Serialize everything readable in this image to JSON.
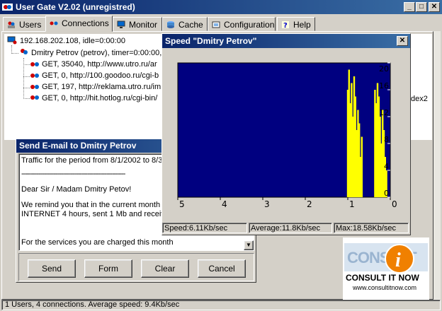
{
  "app": {
    "title": "User Gate V2.02 (unregistred)",
    "controls": {
      "minimize": "_",
      "maximize": "□",
      "close": "✕"
    }
  },
  "tabs": [
    {
      "label": "Users",
      "icon": "users-icon",
      "active": false
    },
    {
      "label": "Connections",
      "icon": "connections-icon",
      "active": true
    },
    {
      "label": "Monitor",
      "icon": "monitor-icon",
      "active": false
    },
    {
      "label": "Cache",
      "icon": "cache-icon",
      "active": false
    },
    {
      "label": "Configuration",
      "icon": "configuration-icon",
      "active": false
    },
    {
      "label": "Help",
      "icon": "help-icon",
      "active": false
    }
  ],
  "tree": {
    "root": "192.168.202.108, idle=0:00:00",
    "user": "Dmitry Petrov (petrov), timer=0:00:00, id",
    "requests": [
      "GET, 35040, http://www.utro.ru/ar",
      "GET, 0, http://100.goodoo.ru/cgi-b",
      "GET, 197, http://reklama.utro.ru/im",
      "GET, 0, http://hit.hotlog.ru/cgi-bin/"
    ],
    "right_fragment": "dex2"
  },
  "email_dialog": {
    "title": "Send E-mail to Dmitry Petrov",
    "period_line": "Traffic for the period from  8/1/2002 to 8/3",
    "separator": "-------------------------------------------------------",
    "greeting": "Dear Sir / Madam Dmitry Petov!",
    "body_line1": "We remind you that in the current month yo",
    "body_line2": "INTERNET 4 hours, sent 1 Mb and receiv",
    "body_line3": "For the services you are charged this month",
    "buttons": {
      "send": "Send",
      "form": "Form",
      "clear": "Clear",
      "cancel": "Cancel"
    }
  },
  "speed_window": {
    "title": "Speed \"Dmitry Petrov\"",
    "close": "✕",
    "status": {
      "speed": "Speed:6.11Kb/sec",
      "average": "Average:11.8Kb/sec",
      "max": "Max:18.58Kb/sec"
    },
    "colors": {
      "plot_bg": "#000080",
      "bar": "#ffff00"
    }
  },
  "chart_data": {
    "type": "bar",
    "title": "",
    "xlabel": "",
    "ylabel": "",
    "x_ticks": [
      "5",
      "4",
      "3",
      "2",
      "1",
      "0"
    ],
    "y_ticks": [
      "20",
      "16",
      "12",
      "8",
      "4",
      "0"
    ],
    "xlim": [
      5,
      0
    ],
    "ylim": [
      0,
      20
    ],
    "grid": false,
    "x": [
      1.0,
      0.97,
      0.94,
      0.91,
      0.88,
      0.85,
      0.82,
      0.79,
      0.76,
      0.73,
      0.7,
      0.67,
      0.36,
      0.33,
      0.3,
      0.27,
      0.24,
      0.21,
      0.18,
      0.15,
      0.12,
      0.09
    ],
    "values": [
      16,
      19,
      14,
      17,
      12,
      18,
      15,
      10,
      13,
      11,
      6,
      9,
      16,
      14,
      17,
      15,
      12,
      8,
      13,
      10,
      6,
      4
    ]
  },
  "logo": {
    "brand": "CONSULT IT NOW",
    "url": "www.consultitnow.com"
  },
  "statusbar": "1 Users, 4 connections. Average speed: 9.4Kb/sec"
}
